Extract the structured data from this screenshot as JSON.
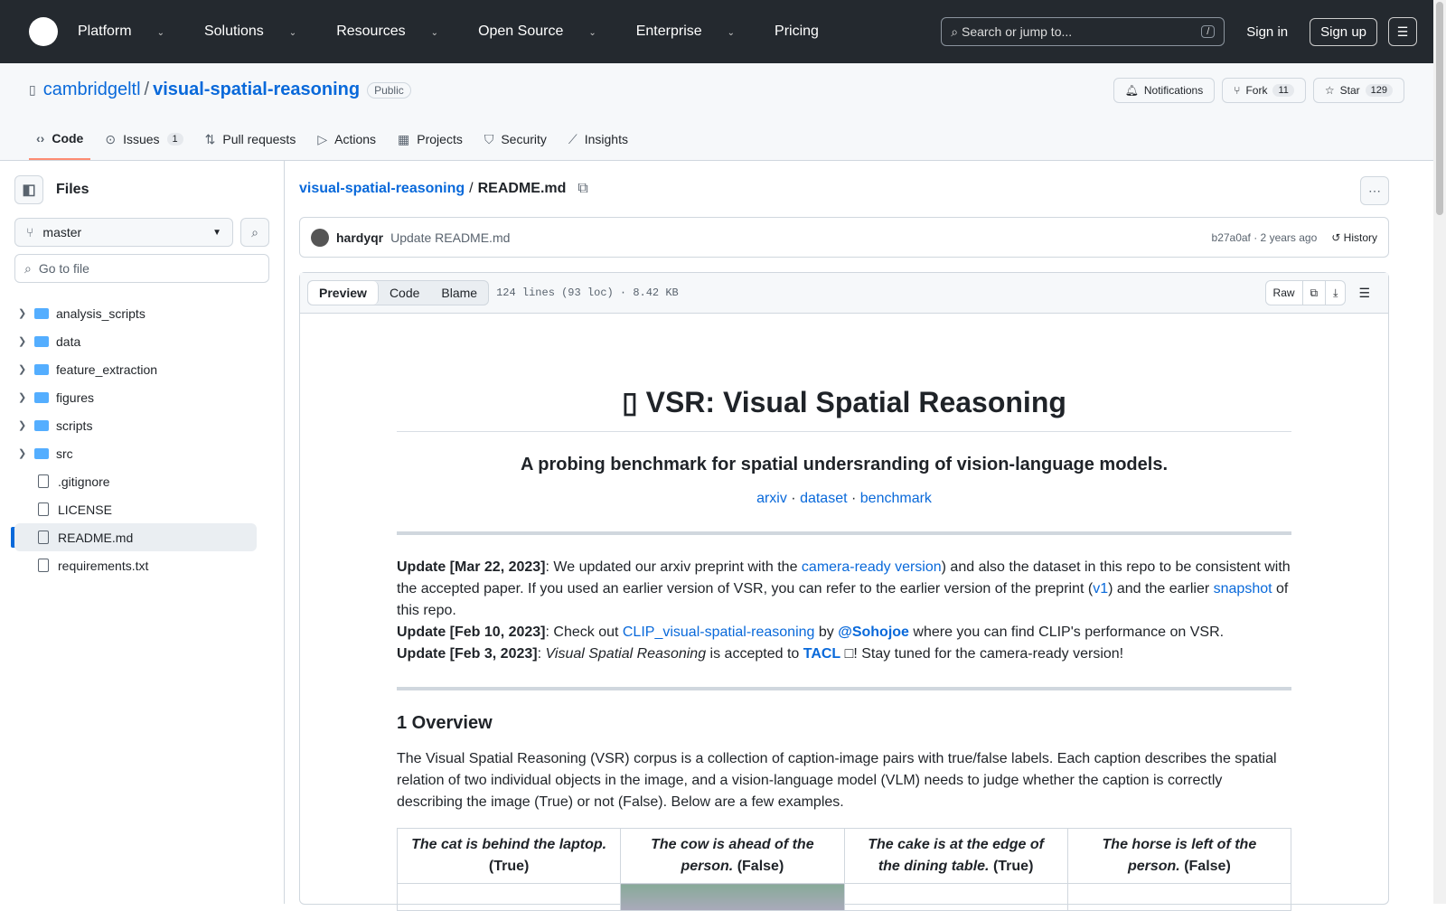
{
  "header": {
    "nav": [
      "Platform",
      "Solutions",
      "Resources",
      "Open Source",
      "Enterprise",
      "Pricing"
    ],
    "nav_has_chevron": [
      true,
      true,
      true,
      true,
      true,
      false
    ],
    "search_placeholder": "Search or jump to...",
    "slash": "/",
    "sign_in": "Sign in",
    "sign_up": "Sign up"
  },
  "repo": {
    "owner": "cambridgeltl",
    "sep": "/",
    "name": "visual-spatial-reasoning",
    "visibility": "Public",
    "notifications": "Notifications",
    "fork": "Fork",
    "fork_count": "11",
    "star": "Star",
    "star_count": "129"
  },
  "tabs": [
    {
      "label": "Code",
      "icon": "code"
    },
    {
      "label": "Issues",
      "count": "1"
    },
    {
      "label": "Pull requests"
    },
    {
      "label": "Actions"
    },
    {
      "label": "Projects"
    },
    {
      "label": "Security"
    },
    {
      "label": "Insights"
    }
  ],
  "sidebar": {
    "title": "Files",
    "branch": "master",
    "goto_placeholder": "Go to file",
    "items": [
      {
        "label": "analysis_scripts",
        "type": "dir"
      },
      {
        "label": "data",
        "type": "dir"
      },
      {
        "label": "feature_extraction",
        "type": "dir"
      },
      {
        "label": "figures",
        "type": "dir"
      },
      {
        "label": "scripts",
        "type": "dir"
      },
      {
        "label": "src",
        "type": "dir"
      },
      {
        "label": ".gitignore",
        "type": "file"
      },
      {
        "label": "LICENSE",
        "type": "file"
      },
      {
        "label": "README.md",
        "type": "file",
        "selected": true
      },
      {
        "label": "requirements.txt",
        "type": "file"
      }
    ]
  },
  "breadcrumb": {
    "repo": "visual-spatial-reasoning",
    "sep": "/",
    "file": "README.md"
  },
  "commit": {
    "author": "hardyqr",
    "message": "Update README.md",
    "sha_time": "b27a0af · 2 years ago",
    "history": "History"
  },
  "filebar": {
    "preview": "Preview",
    "code": "Code",
    "blame": "Blame",
    "meta": "124 lines (93 loc) · 8.42 KB",
    "raw": "Raw"
  },
  "readme": {
    "title": "VSR: Visual Spatial Reasoning",
    "subtitle": "A probing benchmark for spatial undersranding of vision-language models.",
    "links": [
      "arxiv",
      "dataset",
      "benchmark"
    ],
    "link_sep": " · ",
    "u1_label": "Update [Mar 22, 2023]",
    "u1_a": ": We updated our arxiv preprint with the ",
    "u1_link1": "camera-ready version",
    "u1_b": ") and also the dataset in this repo to be consistent with the accepted paper. If you used an earlier version of VSR, you can refer to the earlier version of the preprint (",
    "u1_link2": "v1",
    "u1_c": ") and the earlier ",
    "u1_link3": "snapshot",
    "u1_d": " of this repo.",
    "u2_label": "Update [Feb 10, 2023]",
    "u2_a": ": Check out ",
    "u2_link1": "CLIP_visual-spatial-reasoning",
    "u2_b": " by ",
    "u2_link2": "@Sohojoe",
    "u2_c": " where you can find CLIP's performance on VSR.",
    "u3_label": "Update [Feb 3, 2023]",
    "u3_a": ": ",
    "u3_em": "Visual Spatial Reasoning",
    "u3_b": " is accepted to ",
    "u3_link": "TACL",
    "u3_c": " □! Stay tuned for the camera-ready version!",
    "overview_title": "1 Overview",
    "overview": "The Visual Spatial Reasoning (VSR) corpus is a collection of caption-image pairs with true/false labels. Each caption describes the spatial relation of two individual objects in the image, and a vision-language model (VLM) needs to judge whether the caption is correctly describing the image (True) or not (False). Below are a few examples.",
    "examples": [
      {
        "caption": "The cat is behind the laptop.",
        "label": "(True)"
      },
      {
        "caption": "The cow is ahead of the person.",
        "label": "(False)"
      },
      {
        "caption": "The cake is at the edge of the dining table.",
        "label": "(True)"
      },
      {
        "caption": "The horse is left of the person.",
        "label": "(False)"
      }
    ]
  }
}
